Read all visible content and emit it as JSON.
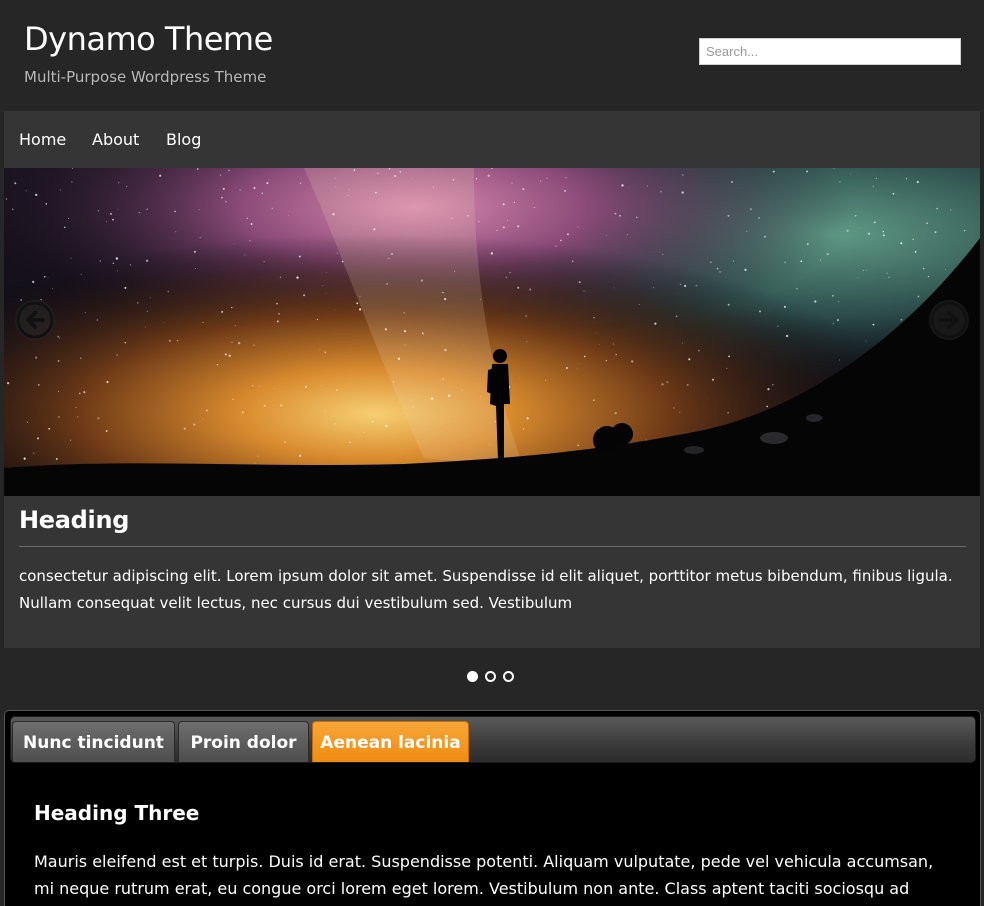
{
  "header": {
    "site_title": "Dynamo Theme",
    "tagline": "Multi-Purpose Wordpress Theme",
    "search_placeholder": "Search..."
  },
  "nav": {
    "items": [
      {
        "label": "Home"
      },
      {
        "label": "About"
      },
      {
        "label": "Blog"
      }
    ]
  },
  "slider": {
    "image_icon": "night-sky-milky-way-photo",
    "prev_icon": "arrow-left-icon",
    "next_icon": "arrow-right-icon",
    "caption_heading": "Heading",
    "caption_text": "consectetur adipiscing elit. Lorem ipsum dolor sit amet. Suspendisse id elit aliquet, porttitor metus bibendum, finibus ligula. Nullam consequat velit lectus, nec cursus dui vestibulum sed. Vestibulum",
    "slide_count": 3,
    "active_slide": 1
  },
  "tabs": {
    "items": [
      {
        "label": "Nunc tincidunt"
      },
      {
        "label": "Proin dolor"
      },
      {
        "label": "Aenean lacinia"
      }
    ],
    "active_index": 2,
    "content_heading": "Heading Three",
    "content_text": "Mauris eleifend est et turpis. Duis id erat. Suspendisse potenti. Aliquam vulputate, pede vel vehicula accumsan, mi neque rutrum erat, eu congue orci lorem eget lorem. Vestibulum non ante. Class aptent taciti sociosqu ad litora"
  },
  "colors": {
    "page_bg": "#262627",
    "panel_bg": "#353536",
    "accent_tab": "#f08a0f"
  }
}
